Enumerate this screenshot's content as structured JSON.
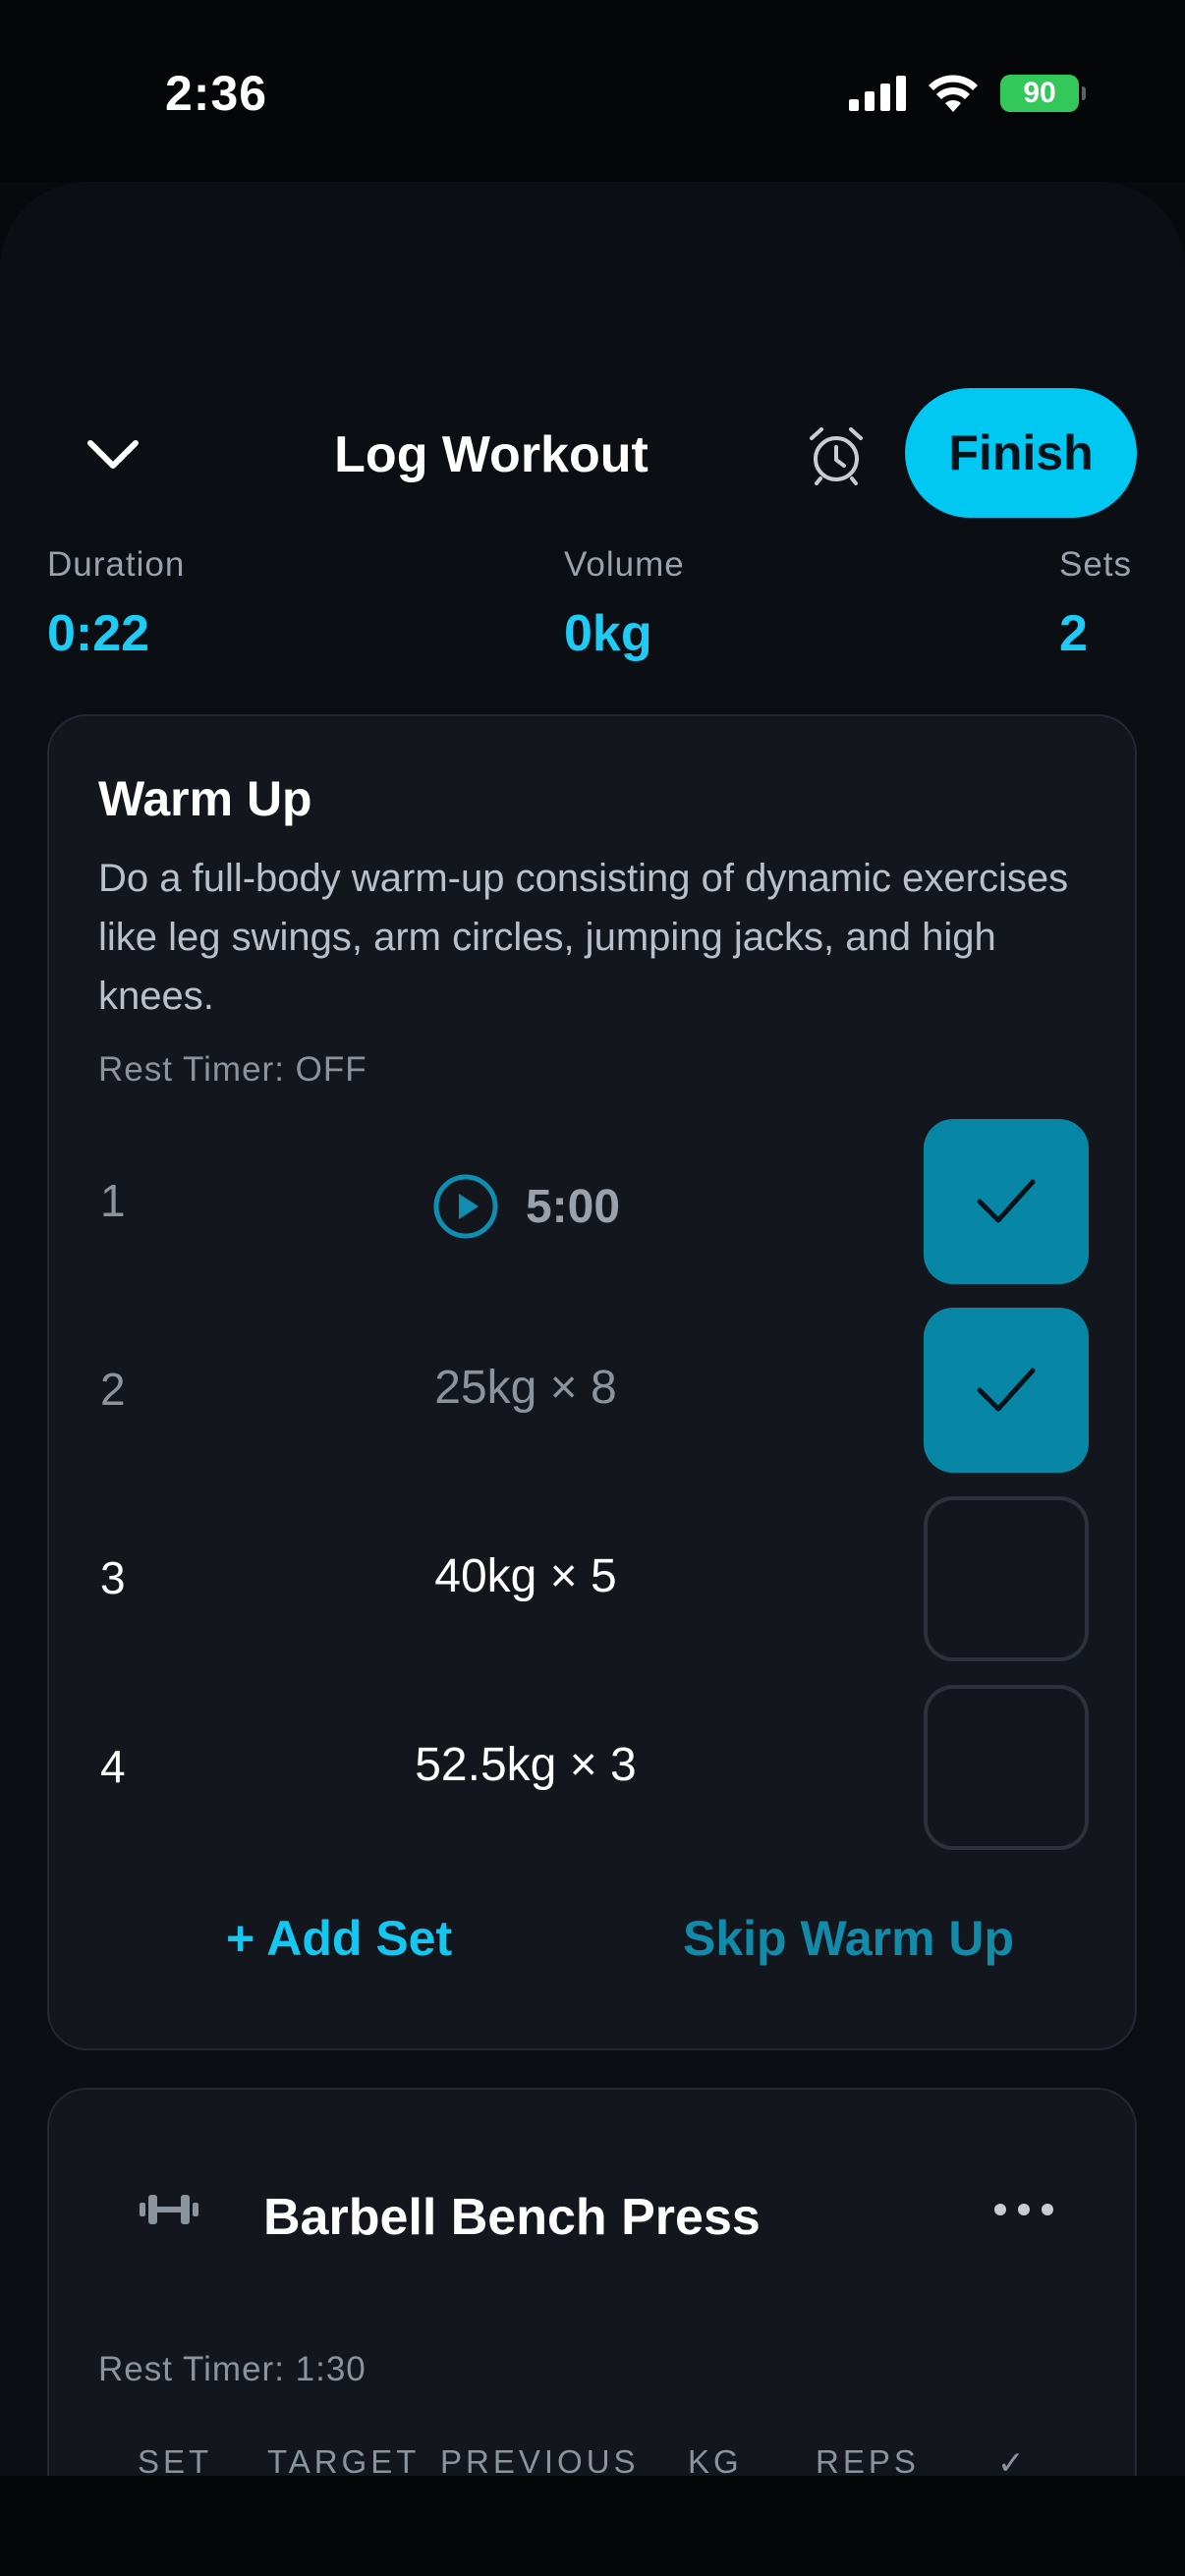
{
  "status_bar": {
    "time": "2:36",
    "battery": "90"
  },
  "header": {
    "title": "Log Workout",
    "finish_label": "Finish"
  },
  "stats": [
    {
      "label": "Duration",
      "value": "0:22"
    },
    {
      "label": "Volume",
      "value": "0kg"
    },
    {
      "label": "Sets",
      "value": "2"
    }
  ],
  "warmup": {
    "title": "Warm Up",
    "description": "Do a full-body warm-up consisting of dynamic exercises like leg swings, arm circles, jumping jacks, and high knees.",
    "rest_timer": "Rest Timer: OFF",
    "sets": [
      {
        "num": "1",
        "value": "5:00",
        "completed": true
      },
      {
        "num": "2",
        "value": "25kg × 8",
        "completed": true
      },
      {
        "num": "3",
        "value": "40kg × 5",
        "completed": false
      },
      {
        "num": "4",
        "value": "52.5kg × 3",
        "completed": false
      }
    ],
    "add_set_label": "+ Add Set",
    "skip_label": "Skip Warm Up"
  },
  "exercise": {
    "name": "Barbell Bench Press",
    "rest_timer": "Rest Timer: 1:30",
    "columns": [
      "SET",
      "TARGET",
      "PREVIOUS",
      "KG",
      "REPS",
      "✓"
    ]
  },
  "colors": {
    "accent": "#00c8f3",
    "check_done": "#0886a5"
  },
  "icons": [
    "chevron-down-icon",
    "alarm-clock-icon",
    "play-icon",
    "checkmark-icon",
    "dumbbell-icon",
    "more-icon"
  ]
}
